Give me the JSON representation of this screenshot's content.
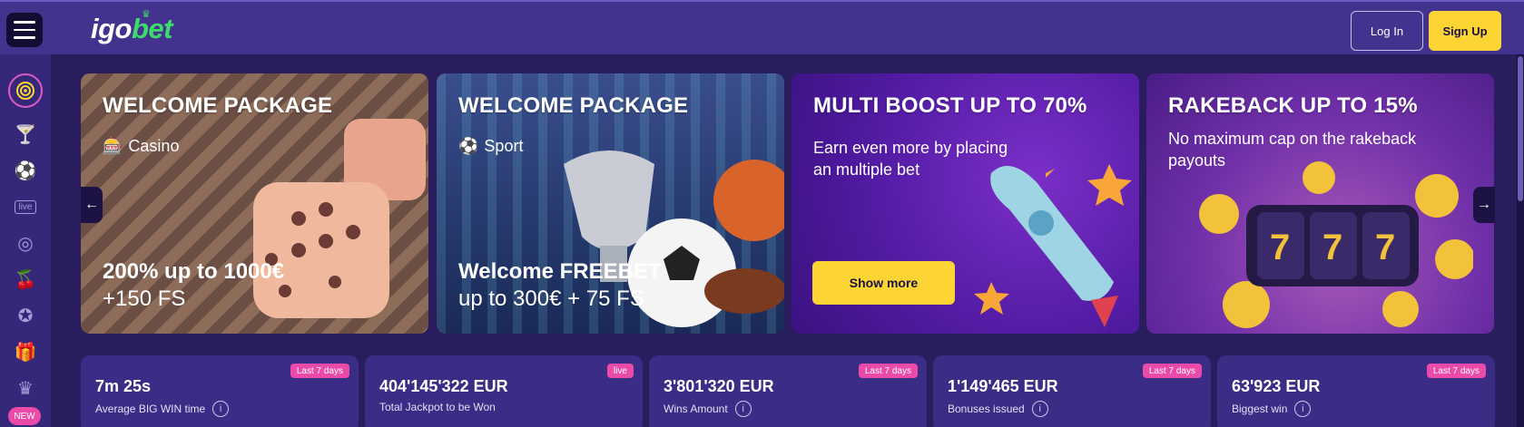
{
  "header": {
    "logo_part1": "igo",
    "logo_part2": "bet",
    "login_label": "Log In",
    "signup_label": "Sign Up"
  },
  "sidebar": {
    "icons": [
      "target-icon",
      "cocktail-icon",
      "soccer-ball-icon",
      "live-tv-icon",
      "roulette-icon",
      "cherries-icon",
      "poker-chip-icon",
      "gift-icon",
      "crown-icon"
    ],
    "live_label": "live",
    "new_badge": "NEW"
  },
  "banners": [
    {
      "title": "WELCOME PACKAGE",
      "sub": "Casino",
      "offer_bold": "200% up to 1000€",
      "offer": "+150 FS"
    },
    {
      "title": "WELCOME PACKAGE",
      "sub": "Sport",
      "offer_bold": "Welcome FREEBET",
      "offer": "up to 300€ + 75 FS"
    },
    {
      "title": "MULTI BOOST UP TO 70%",
      "desc": "Earn even more by placing an multiple bet",
      "button": "Show more"
    },
    {
      "title": "RAKEBACK UP TO 15%",
      "desc": "No maximum cap on the rakeback payouts"
    }
  ],
  "stats": [
    {
      "badge": "Last 7 days",
      "value": "7m 25s",
      "label": "Average BIG WIN time"
    },
    {
      "badge": "live",
      "value": "404'145'322 EUR",
      "label": "Total Jackpot to be Won"
    },
    {
      "badge": "Last 7 days",
      "value": "3'801'320 EUR",
      "label": "Wins Amount"
    },
    {
      "badge": "Last 7 days",
      "value": "1'149'465 EUR",
      "label": "Bonuses issued"
    },
    {
      "badge": "Last 7 days",
      "value": "63'923 EUR",
      "label": "Biggest win"
    }
  ],
  "colors": {
    "header_bg": "#43338f",
    "page_bg": "#2a1d5e",
    "accent_yellow": "#fcd535",
    "badge_pink": "#ec4aa8",
    "logo_green": "#3ddb6a"
  }
}
